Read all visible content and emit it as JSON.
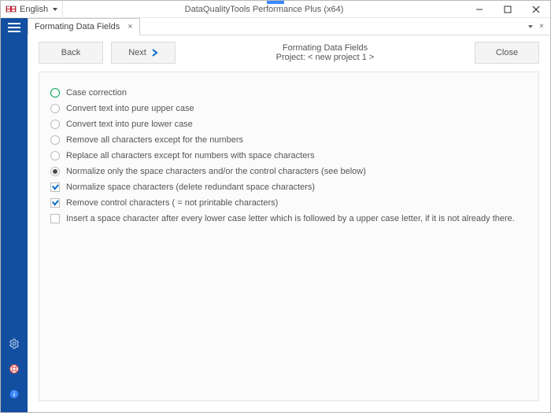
{
  "titlebar": {
    "language": "English",
    "app_title": "DataQualityTools Performance Plus (x64)"
  },
  "tab": {
    "label": "Formating Data Fields"
  },
  "toolbar": {
    "back_label": "Back",
    "next_label": "Next",
    "close_label": "Close",
    "heading": "Formating Data Fields",
    "subheading": "Project: < new project 1 >"
  },
  "options": {
    "r1": "Case correction",
    "r2": "Convert text into pure upper case",
    "r3": "Convert text into pure lower case",
    "r4": "Remove all characters except for the numbers",
    "r5": "Replace all characters except for numbers with space characters",
    "r6": "Normalize only the space characters and/or the control characters (see below)",
    "c1": "Normalize space characters (delete redundant space characters)",
    "c2": "Remove control characters ( = not printable characters)",
    "c3": "Insert a space character after every lower case letter which is followed by a upper case letter, if it is not already there."
  }
}
